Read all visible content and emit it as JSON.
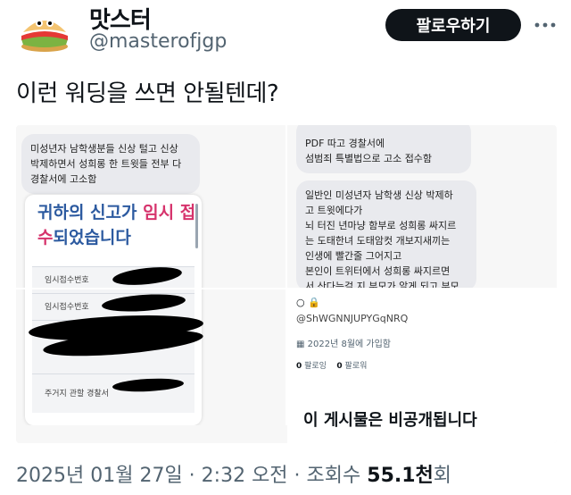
{
  "author": {
    "display_name": "맛스터",
    "handle": "@masterofjgp",
    "avatar_icon": "sandwich-avatar-icon"
  },
  "header": {
    "follow_label": "팔로우하기",
    "more_icon": "more-horizontal-icon"
  },
  "tweet": {
    "text": "이런 워딩을 쓰면 안될텐데?"
  },
  "media": {
    "left_bubble": [
      "미성년자 남학생분들 신상 털고 신상",
      "박제하면서 성희롱 한 트윗들 전부 다",
      "경찰서에 고소함"
    ],
    "right_top_bubble": [
      "PDF 따고 경찰서에",
      "섬범죄 특별법으로 고소 접수함"
    ],
    "right_bubble": [
      "일반인 미성년자 남학생 신상 박제하",
      "고 트윗에다가",
      "뇌 터진 년마냥 함부로 성희롱 싸지르",
      "는 도태한녀 도태암컷 개보지새끼는",
      "인생에 빨간줄 그어지고",
      "본인이 트위터에서 성희롱 싸지르면",
      "서 산다는걸 지 부모가 알게 되고 부모"
    ],
    "dialog": {
      "title_part1": "귀하의 신고가 ",
      "title_part2": "임시 접",
      "title_part3": "수",
      "title_part4": "되었습니다",
      "rows": [
        "임시접수번호",
        "임시접수번호",
        "",
        "주거지 관할 경찰서"
      ]
    },
    "profile": {
      "icons": "○ 🔒",
      "handle": "@ShWGNNJUPYGqNRQ",
      "joined": "2022년 8월에 가입함",
      "following_count": "0",
      "following_label": " 팔로잉",
      "followers_count": "0",
      "followers_label": " 팔로워",
      "private_notice": "이 게시물은 비공개됩니다"
    }
  },
  "meta": {
    "date": "2025년 01월 27일",
    "sep1": " · ",
    "time": "2:32 오전",
    "sep2": " · ",
    "views_label": "조회수 ",
    "views_count": "55.1천",
    "views_suffix": "회"
  }
}
